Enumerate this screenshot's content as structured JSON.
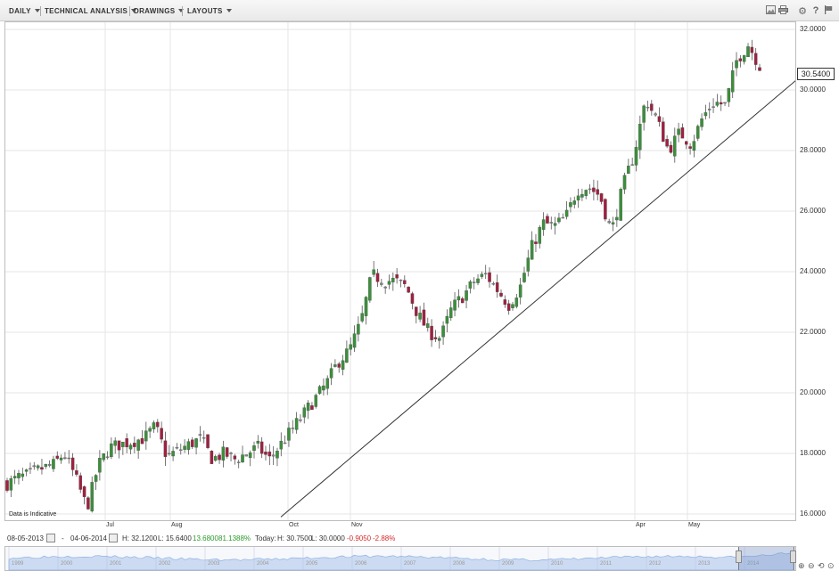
{
  "toolbar": {
    "menus": [
      {
        "label": "DAILY"
      },
      {
        "label": "TECHNICAL ANALYSIS"
      },
      {
        "label": "DRAWINGS"
      },
      {
        "label": "LAYOUTS"
      }
    ],
    "icons": [
      "image-icon",
      "print-icon",
      "gear-icon",
      "help-icon",
      "flag-icon"
    ]
  },
  "chart_data": {
    "type": "candlestick",
    "y_axis": {
      "min": 15.64,
      "max": 32.12,
      "ticks": [
        "16.0000",
        "18.0000",
        "20.0000",
        "22.0000",
        "24.0000",
        "26.0000",
        "28.0000",
        "30.0000",
        "32.0000"
      ],
      "grid": true
    },
    "x_axis": {
      "tick_labels": [
        "Jul",
        "Aug",
        "Oct",
        "Nov",
        "Apr",
        "May"
      ],
      "grid": true
    },
    "last_value": "30.5400",
    "note": "Data is Indicative",
    "trendline": {
      "from": [
        "Sep",
        15.9
      ],
      "to": [
        "Jun",
        30.3
      ]
    },
    "close_path": [
      17.0,
      17.2,
      17.3,
      17.5,
      17.6,
      18.0,
      17.2,
      16.2,
      17.6,
      18.2,
      18.3,
      18.4,
      18.5,
      18.9,
      17.9,
      18.1,
      18.3,
      18.5,
      17.8,
      18.0,
      17.8,
      18.0,
      18.2,
      17.8,
      18.3,
      18.8,
      19.3,
      19.8,
      20.3,
      21.0,
      21.4,
      22.3,
      23.9,
      23.7,
      23.7,
      23.5,
      22.6,
      22.0,
      21.8,
      22.8,
      23.2,
      23.7,
      23.9,
      23.4,
      22.9,
      23.5,
      24.8,
      25.6,
      25.5,
      25.8,
      26.7,
      26.8,
      26.5,
      25.3,
      26.8,
      27.9,
      29.7,
      29.0,
      28.0,
      28.6,
      28.2,
      29.1,
      29.6,
      29.5,
      31.0,
      31.5,
      30.8
    ]
  },
  "status_bar": {
    "date_from": "08-05-2013",
    "dash": "-",
    "date_to": "04-06-2014",
    "range_high": "H: 32.1200",
    "range_low": "L: 15.6400",
    "change": "13.6800",
    "change_pct": "81.1388%",
    "today_label": "Today:",
    "today_high": "H: 30.7500",
    "today_low": "L: 30.0000",
    "today_change": "-0.9050",
    "today_change_pct": "-2.88%",
    "colors": {
      "up": "#2a9a2a",
      "down": "#d42a2a"
    }
  },
  "navigator": {
    "years": [
      "1999",
      "2000",
      "2001",
      "2002",
      "2003",
      "2004",
      "2005",
      "2006",
      "2007",
      "2008",
      "2009",
      "2010",
      "2011",
      "2012",
      "2013",
      "2014"
    ]
  },
  "colors": {
    "up_candle": "#3b8f3b",
    "down_candle": "#a02040",
    "neutral_candle": "#888888",
    "grid": "#e6e6e6"
  }
}
